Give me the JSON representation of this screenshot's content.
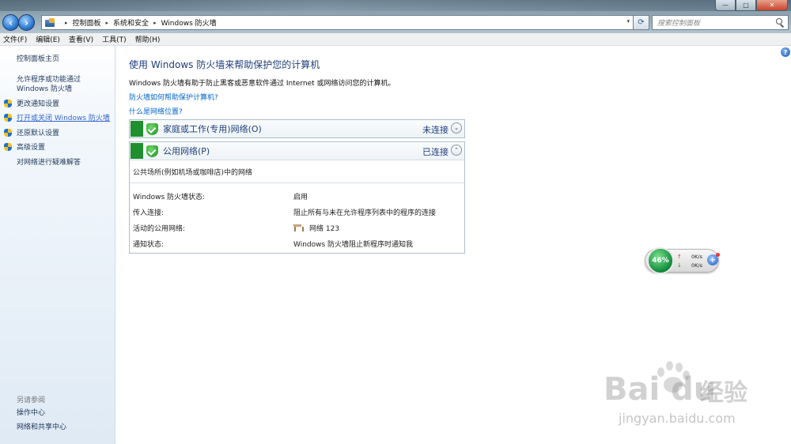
{
  "window": {
    "minimize_glyph": "—",
    "maximize_glyph": "□",
    "close_glyph": "✕"
  },
  "address_bar": {
    "crumbs": [
      "控制面板",
      "系统和安全",
      "Windows 防火墙"
    ],
    "separator": "▸",
    "dropdown": "▾"
  },
  "search": {
    "placeholder": "搜索控制面板"
  },
  "menu": [
    "文件(F)",
    "编辑(E)",
    "查看(V)",
    "工具(T)",
    "帮助(H)"
  ],
  "sidebar": {
    "home": "控制面板主页",
    "items": [
      {
        "label": "允许程序或功能通过 Windows 防火墙",
        "icon": "none"
      },
      {
        "label": "更改通知设置",
        "icon": "uac-shield-icon"
      },
      {
        "label": "打开或关闭 Windows 防火墙",
        "icon": "uac-shield-icon"
      },
      {
        "label": "还原默认设置",
        "icon": "uac-shield-icon"
      },
      {
        "label": "高级设置",
        "icon": "uac-shield-icon"
      },
      {
        "label": "对网络进行疑难解答",
        "icon": "none"
      }
    ],
    "see_also": "另请参阅",
    "see_also_links": [
      "操作中心",
      "网络和共享中心"
    ]
  },
  "main": {
    "title": "使用 Windows 防火墙来帮助保护您的计算机",
    "description": "Windows 防火墙有助于防止黑客或恶意软件通过 Internet 或网络访问您的计算机。",
    "links": [
      "防火墙如何帮助保护计算机?",
      "什么是网络位置?"
    ],
    "help_glyph": "?"
  },
  "networks": {
    "home": {
      "name": "家庭或工作(专用)网络(O)",
      "status": "未连接",
      "chevron": "⌄"
    },
    "public": {
      "name": "公用网络(P)",
      "status": "已连接",
      "chevron": "⌃",
      "subtitle": "公共场所(例如机场或咖啡店)中的网络",
      "details": [
        {
          "label": "Windows 防火墙状态:",
          "value": "启用"
        },
        {
          "label": "传入连接:",
          "value": "阻止所有与未在允许程序列表中的程序的连接"
        },
        {
          "label": "活动的公用网络:",
          "value": "网络  123"
        },
        {
          "label": "通知状态:",
          "value": "Windows 防火墙阻止新程序时通知我"
        }
      ]
    }
  },
  "gadget": {
    "percent": "46%",
    "upload": "0K/s",
    "download": "0K/s",
    "up_arrow": "↑",
    "down_arrow": "↓",
    "plus": "+"
  },
  "watermark": {
    "brand": "Bai du",
    "brand_zh": "经验",
    "url": "jingyan.baidu.com"
  },
  "colors": {
    "heading": "#1e3e7c",
    "link": "#0066cc",
    "status_green": "#1f8f2f",
    "sidebar_link": "#1e395b"
  }
}
